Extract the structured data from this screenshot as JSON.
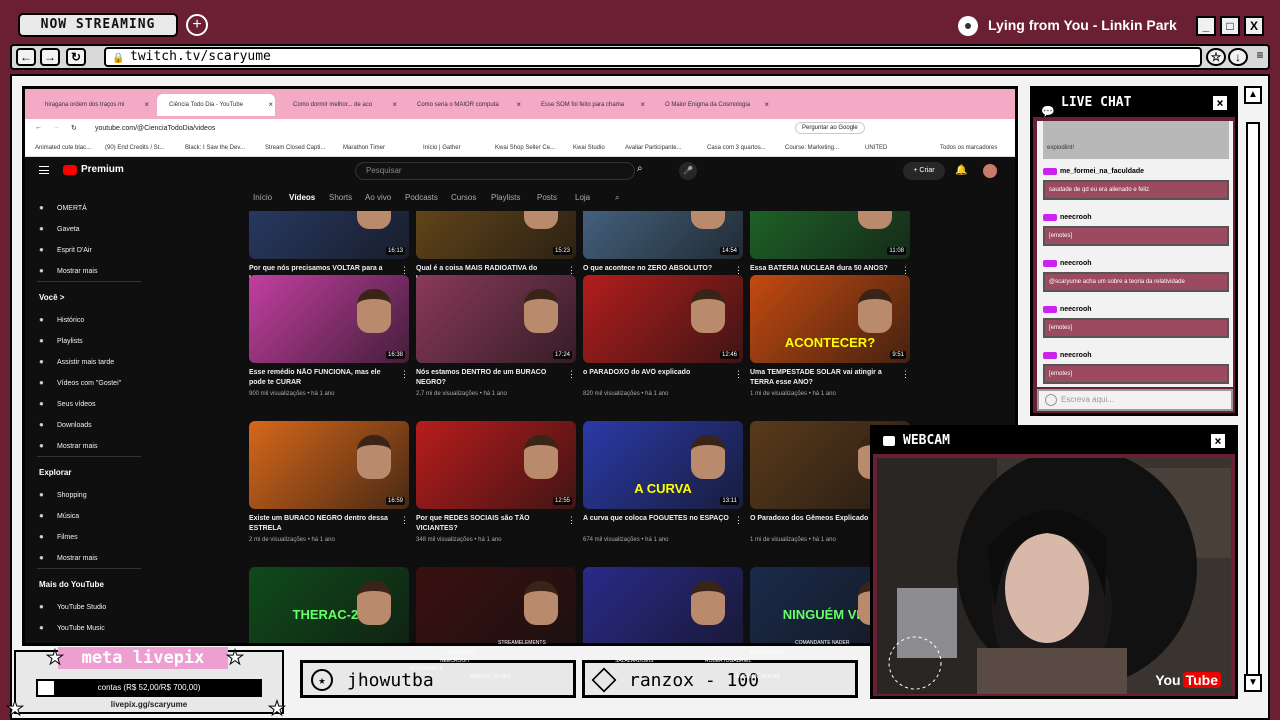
{
  "stream": {
    "badge": "NOW STREAMING",
    "plus": "+",
    "now_playing": "Lying from You - Linkin Park",
    "window_buttons": [
      "_",
      "□",
      "X"
    ]
  },
  "browser": {
    "url": "twitch.tv/scaryume",
    "nav": [
      "←",
      "→",
      "↻"
    ]
  },
  "chrome": {
    "tabs": [
      {
        "label": "hiragana ordem dos traços mi",
        "active": false
      },
      {
        "label": "Ciência Todo Dia - YouTube",
        "active": true
      },
      {
        "label": "Como dormir melhor... de aco",
        "active": false
      },
      {
        "label": "Como seria o MAIOR computa",
        "active": false
      },
      {
        "label": "Esse SOM foi feito para chama",
        "active": false
      },
      {
        "label": "O Maior Enigma da Cosmologia",
        "active": false
      }
    ],
    "url": "youtube.com/@CienciaTodoDia/videos",
    "google_btn": "Perguntar ao Google",
    "bookmarks": [
      "Animated cute blac...",
      "(90) End Credits / St...",
      "Black: I Saw the Dev...",
      "Stream Closed Capti...",
      "Marathon Timer",
      "Início | Gather",
      "Kwai Shop Seller Ce...",
      "Kwai Studio",
      "Avaliar Participante...",
      "Casa com 3 quartos...",
      "Course: Marketing...",
      "UNITED",
      "Todos os marcadores"
    ]
  },
  "youtube": {
    "logo": "Premium",
    "search_placeholder": "Pesquisar",
    "create": "+ Criar",
    "tabs": [
      "Início",
      "Vídeos",
      "Shorts",
      "Ao vivo",
      "Podcasts",
      "Cursos",
      "Playlists",
      "Posts",
      "Loja"
    ],
    "sidebar": {
      "top_items": [
        "OMERTÁ",
        "Gaveta",
        "Esprit D'Air",
        "Mostrar mais"
      ],
      "voce_header": "Você  >",
      "voce_items": [
        "Histórico",
        "Playlists",
        "Assistir mais tarde",
        "Vídeos com \"Gostei\"",
        "Seus vídeos",
        "Downloads",
        "Mostrar mais"
      ],
      "explore_header": "Explorar",
      "explore_items": [
        "Shopping",
        "Música",
        "Filmes",
        "Mostrar mais"
      ],
      "more_header": "Mais do YouTube",
      "more_items": [
        "YouTube Studio",
        "YouTube Music"
      ]
    },
    "videos": [
      {
        "title": "Por que nós precisamos VOLTAR para a LUA?",
        "meta": "1,4 mi de visualizações • há 1 ano",
        "duration": "16:13",
        "color": "#2a3d6b",
        "overlay": ""
      },
      {
        "title": "Qual é a coisa MAIS RADIOATIVA do UNIVERSO?",
        "meta": "1,3 mi de visualizações • há 1 ano",
        "duration": "15:23",
        "color": "#6b4a1a",
        "overlay": ""
      },
      {
        "title": "O que acontece no ZERO ABSOLUTO?",
        "meta": "1,6 mi de visualizações • há 1 ano",
        "duration": "14:54",
        "color": "#4a6b8b",
        "overlay": ""
      },
      {
        "title": "Essa BATERIA NUCLEAR dura 50 ANOS?",
        "meta": "423 mil visualizações • há 1 ano",
        "duration": "11:08",
        "color": "#1f6b2a",
        "overlay": ""
      },
      {
        "title": "Esse remédio NÃO FUNCIONA, mas ele pode te CURAR",
        "meta": "900 mil visualizações • há 1 ano",
        "duration": "16:38",
        "color": "#c23fa0",
        "overlay": ""
      },
      {
        "title": "Nós estamos DENTRO de um BURACO NEGRO?",
        "meta": "2,7 mi de visualizações • há 1 ano",
        "duration": "17:24",
        "color": "#8a3a5a",
        "overlay": ""
      },
      {
        "title": "o PARADOXO do AVÔ explicado",
        "meta": "820 mil visualizações • há 1 ano",
        "duration": "12:46",
        "color": "#b31d1d",
        "overlay": ""
      },
      {
        "title": "Uma TEMPESTADE SOLAR vai atingir a TERRA esse ANO?",
        "meta": "1 mi de visualizações • há 1 ano",
        "duration": "9:51",
        "color": "#c44a10",
        "overlay": "ACONTECER?"
      },
      {
        "title": "Existe um BURACO NEGRO dentro dessa ESTRELA",
        "meta": "2 mi de visualizações • há 1 ano",
        "duration": "16:59",
        "color": "#d6671a",
        "overlay": ""
      },
      {
        "title": "Por que REDES SOCIAIS são TÃO VICIANTES?",
        "meta": "348 mil visualizações • há 1 ano",
        "duration": "12:55",
        "color": "#b81c1c",
        "overlay": ""
      },
      {
        "title": "A curva que coloca FOGUETES no ESPAÇO",
        "meta": "674 mil visualizações • há 1 ano",
        "duration": "13:11",
        "color": "#2b3aa8",
        "overlay": "A CURVA"
      },
      {
        "title": "O Paradoxo dos Gêmeos Explicado",
        "meta": "1 mi de visualizações • há 1 ano",
        "duration": "",
        "color": "#5a3a1a",
        "overlay": ""
      },
      {
        "title": "",
        "meta": "",
        "duration": "",
        "color": "#0f4a1a",
        "overlay": "THERAC-25"
      },
      {
        "title": "",
        "meta": "",
        "duration": "",
        "color": "#3a1010",
        "overlay": ""
      },
      {
        "title": "",
        "meta": "",
        "duration": "",
        "color": "#2a2a8a",
        "overlay": ""
      },
      {
        "title": "",
        "meta": "",
        "duration": "",
        "color": "#1a2a4a",
        "overlay": "NINGUÉM VIVE"
      }
    ]
  },
  "chat": {
    "title": "LIVE CHAT",
    "top_fragment": "expiodiint!",
    "messages": [
      {
        "user": "me_formei_na_faculdade",
        "text": "saudade de qd eu era alienado e feliz"
      },
      {
        "user": "neecrooh",
        "text": "[emotes]"
      },
      {
        "user": "neecrooh",
        "text": "@scaryume acha um sobre a teoria da relatividade"
      },
      {
        "user": "neecrooh",
        "text": "[emotes]"
      },
      {
        "user": "neecrooh",
        "text": "[emotes]"
      }
    ],
    "input_placeholder": "Escreva aqui..."
  },
  "webcam": {
    "title": "WEBCAM",
    "watermark": "You",
    "watermark_tube": "Tube"
  },
  "goal": {
    "title": "meta livepix",
    "progress_label": "contas (R$ 52,00/R$ 700,00)",
    "progress": 0.074,
    "url": "livepix.gg/scaryume"
  },
  "tickers": [
    {
      "text": "jhowutba"
    },
    {
      "text": "ranzox - 100"
    }
  ],
  "crowd_names": [
    "STREAMELEMENTS",
    "HULKVELI",
    "NEECROOH",
    "ALEXVERDEN",
    "COMANDANTE NADER",
    "BOTIRSEFITE",
    "SALAZARDOEIS",
    "ROBERTOGABRIEL",
    "SUSENIN_MOUJIR",
    "MARCIO_VILHEN"
  ]
}
